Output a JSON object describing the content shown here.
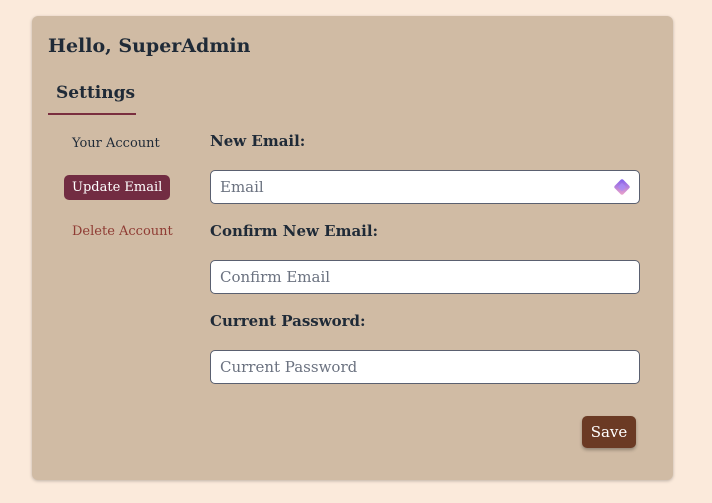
{
  "header": {
    "greeting": "Hello, SuperAdmin"
  },
  "tabs": {
    "settings": "Settings"
  },
  "sidebar": {
    "items": [
      {
        "label": "Your Account"
      },
      {
        "label": "Update Email"
      },
      {
        "label": "Delete Account"
      }
    ]
  },
  "form": {
    "new_email": {
      "label": "New Email:",
      "placeholder": "Email",
      "value": ""
    },
    "confirm_email": {
      "label": "Confirm New Email:",
      "placeholder": "Confirm Email",
      "value": ""
    },
    "current_password": {
      "label": "Current Password:",
      "placeholder": "Current Password",
      "value": ""
    },
    "save_label": "Save",
    "field_icon": "password-manager-icon"
  },
  "colors": {
    "page_bg": "#fbeadb",
    "card_bg": "#d0bba4",
    "active_nav": "#722c42",
    "delete_text": "#8f3b33",
    "save_button": "#6b3a24"
  }
}
